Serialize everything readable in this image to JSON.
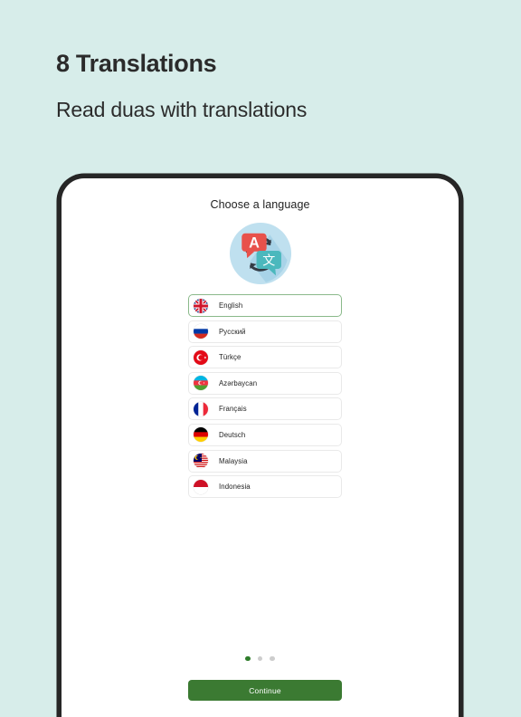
{
  "promo": {
    "title": "8 Translations",
    "subtitle": "Read duas with translations"
  },
  "colors": {
    "background": "#d7edea",
    "phone_bezel": "#262626",
    "accent_green": "#3b7a32",
    "selected_border": "#8ab98a",
    "active_dot": "#2f7d2b",
    "inactive_dot": "#cdcdcd",
    "icon_circle": "#bfe0ef",
    "icon_bubble_red": "#e8514b",
    "icon_bubble_teal": "#4bb8bd"
  },
  "screen": {
    "title": "Choose a language",
    "icon_name": "translate-icon",
    "languages": [
      {
        "label": "English",
        "flag": "flag-uk",
        "selected": true
      },
      {
        "label": "Русский",
        "flag": "flag-russia",
        "selected": false
      },
      {
        "label": "Türkçe",
        "flag": "flag-turkey",
        "selected": false
      },
      {
        "label": "Azərbaycan",
        "flag": "flag-azerbaijan",
        "selected": false
      },
      {
        "label": "Français",
        "flag": "flag-france",
        "selected": false
      },
      {
        "label": "Deutsch",
        "flag": "flag-germany",
        "selected": false
      },
      {
        "label": "Malaysia",
        "flag": "flag-malaysia",
        "selected": false
      },
      {
        "label": "Indonesia",
        "flag": "flag-indonesia",
        "selected": false
      }
    ],
    "pagination": {
      "total": 3,
      "active_index": 0
    },
    "cta_label": "Continue"
  }
}
